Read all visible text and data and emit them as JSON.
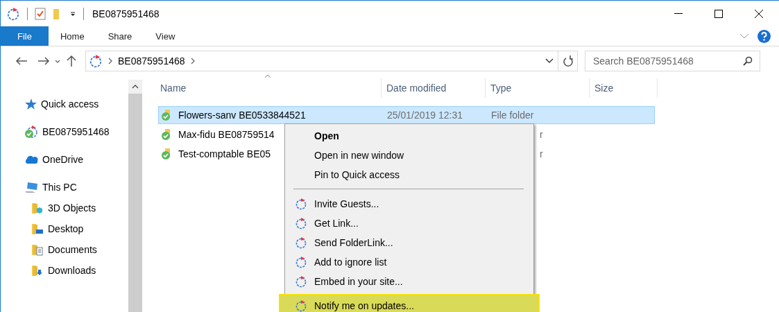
{
  "window": {
    "title": "BE0875951468"
  },
  "ribbon": {
    "tabs": [
      {
        "label": "File",
        "selected": true
      },
      {
        "label": "Home",
        "selected": false
      },
      {
        "label": "Share",
        "selected": false
      },
      {
        "label": "View",
        "selected": false
      }
    ]
  },
  "address_bar": {
    "path": [
      "BE0875951468"
    ]
  },
  "search": {
    "placeholder": "Search BE0875951468"
  },
  "nav_pane": {
    "items": [
      {
        "label": "Quick access",
        "kind": "star"
      },
      {
        "label": "BE0875951468",
        "kind": "sync"
      },
      {
        "label": "OneDrive",
        "kind": "cloud"
      },
      {
        "label": "This PC",
        "kind": "pc",
        "children": [
          {
            "label": "3D Objects",
            "kind": "objects"
          },
          {
            "label": "Desktop",
            "kind": "desktop"
          },
          {
            "label": "Documents",
            "kind": "documents"
          },
          {
            "label": "Downloads",
            "kind": "downloads"
          }
        ]
      }
    ]
  },
  "file_list": {
    "columns": [
      "Name",
      "Date modified",
      "Type",
      "Size"
    ],
    "rows": [
      {
        "name": "Flowers-sanv BE0533844521",
        "date": "25/01/2019 12:31",
        "type": "File folder",
        "selected": true
      },
      {
        "name": "Max-fidu BE08759514",
        "type": "r",
        "selected": false
      },
      {
        "name": "Test-comptable BE05",
        "type": "r",
        "selected": false
      }
    ]
  },
  "context_menu": {
    "items": [
      {
        "kind": "default",
        "label": "Open"
      },
      {
        "kind": "plain",
        "label": "Open in new window"
      },
      {
        "kind": "plain",
        "label": "Pin to Quick access"
      },
      {
        "kind": "separator"
      },
      {
        "kind": "sync",
        "label": "Invite Guests...",
        "highlighted": false
      },
      {
        "kind": "sync",
        "label": "Get Link...",
        "highlighted": false
      },
      {
        "kind": "sync",
        "label": "Send FolderLink...",
        "highlighted": false
      },
      {
        "kind": "sync",
        "label": "Add to ignore list",
        "highlighted": false
      },
      {
        "kind": "sync",
        "label": "Embed in your site...",
        "highlighted": false
      },
      {
        "kind": "sync",
        "label": "Notify me on updates...",
        "highlighted": true
      }
    ]
  }
}
